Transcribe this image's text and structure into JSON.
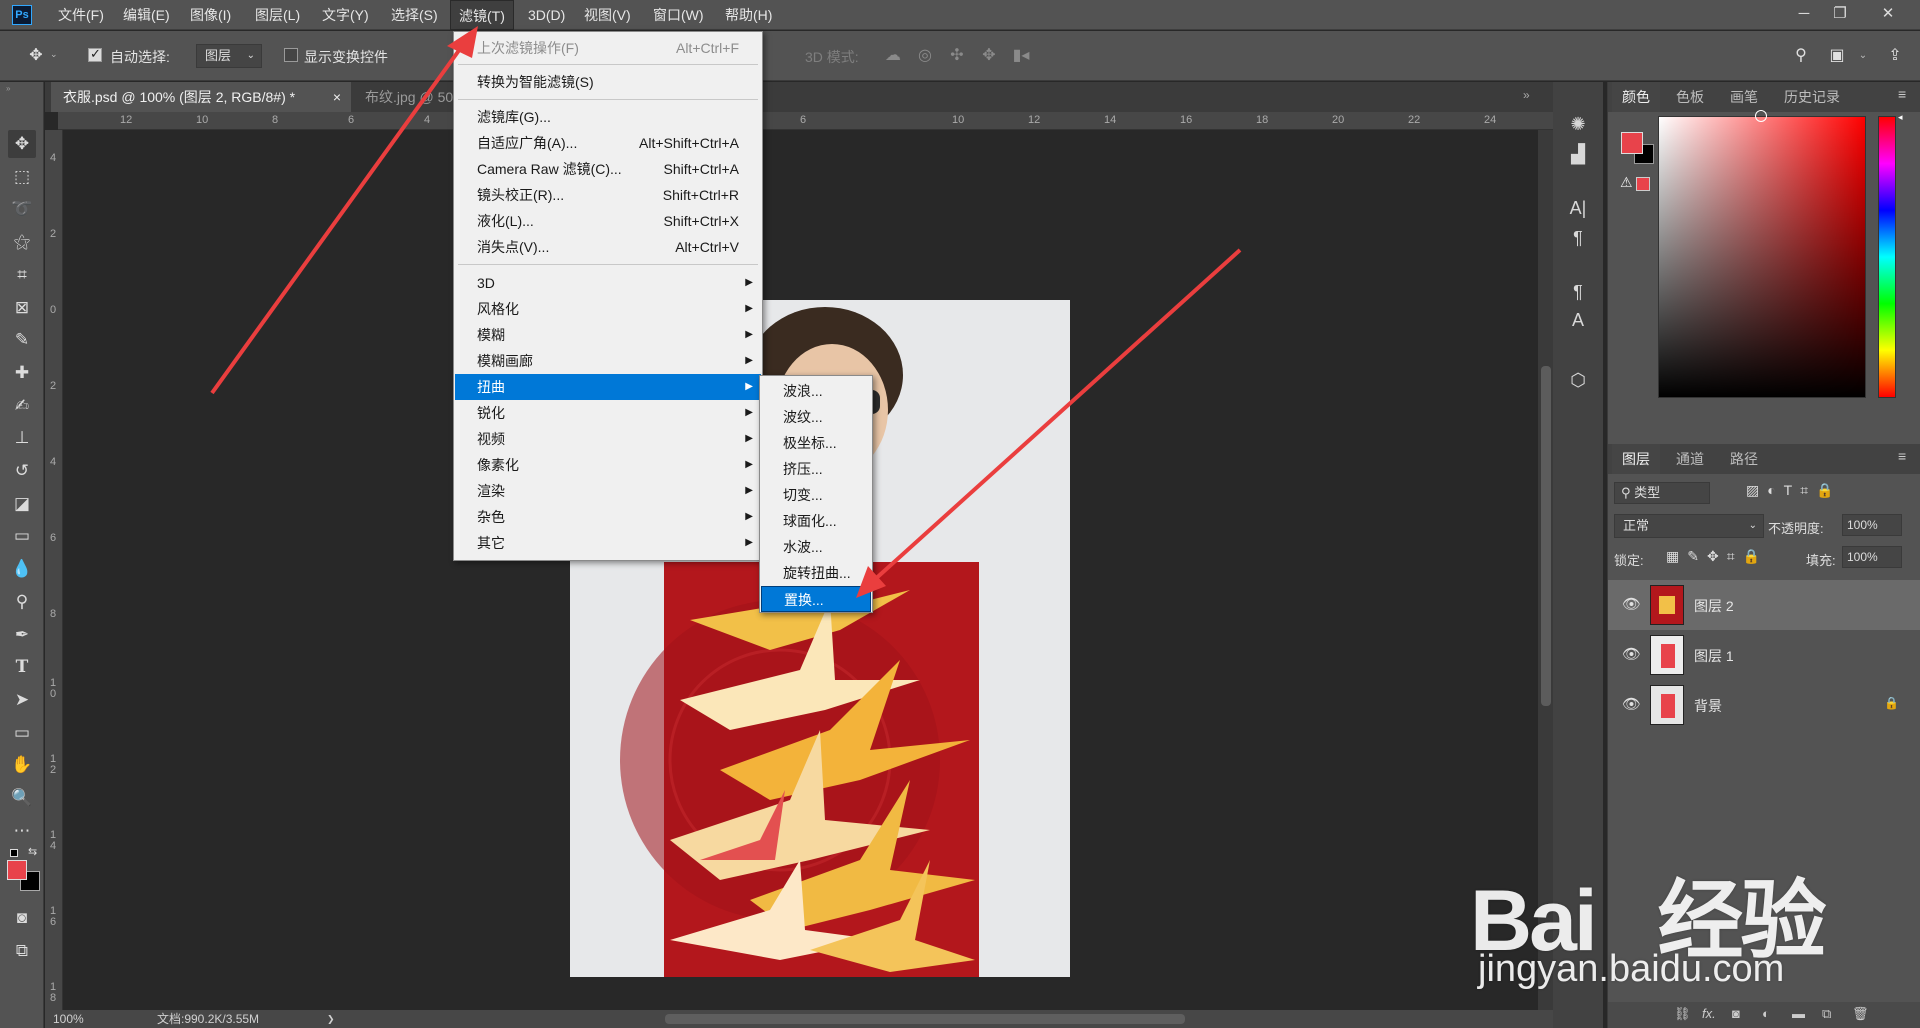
{
  "app": {
    "logo": "Ps"
  },
  "menubar": {
    "items": [
      "文件(F)",
      "编辑(E)",
      "图像(I)",
      "图层(L)",
      "文字(Y)",
      "选择(S)",
      "滤镜(T)",
      "3D(D)",
      "视图(V)",
      "窗口(W)",
      "帮助(H)"
    ],
    "active": "滤镜(T)"
  },
  "window_controls": {
    "minimize": "─",
    "restore": "❐",
    "close": "✕"
  },
  "options_bar": {
    "auto_select_label": "自动选择:",
    "auto_select_checked": true,
    "layer_select_value": "图层",
    "show_transform_label": "显示变换控件",
    "show_transform_checked": false,
    "mode_3d_label": "3D 模式:"
  },
  "tabs": [
    {
      "label": "衣服.psd @ 100% (图层 2, RGB/8#) *",
      "close": "×",
      "active": true
    },
    {
      "label": "布纹.jpg @ 50",
      "active": false
    }
  ],
  "ruler": {
    "h_labels": [
      "12",
      "10",
      "8",
      "6",
      "4",
      "6",
      "10",
      "12",
      "14",
      "16",
      "18",
      "20",
      "22",
      "24"
    ],
    "v_labels": [
      "4",
      "2",
      "0",
      "2",
      "4",
      "6",
      "8",
      "1 0",
      "1 2",
      "1 4",
      "1 6",
      "1 8"
    ]
  },
  "filter_menu": {
    "items": [
      {
        "label": "上次滤镜操作(F)",
        "shortcut": "Alt+Ctrl+F",
        "disabled": true
      },
      {
        "separator": true
      },
      {
        "label": "转换为智能滤镜(S)",
        "shortcut": ""
      },
      {
        "separator": true
      },
      {
        "label": "滤镜库(G)...",
        "shortcut": ""
      },
      {
        "label": "自适应广角(A)...",
        "shortcut": "Alt+Shift+Ctrl+A"
      },
      {
        "label": "Camera Raw 滤镜(C)...",
        "shortcut": "Shift+Ctrl+A"
      },
      {
        "label": "镜头校正(R)...",
        "shortcut": "Shift+Ctrl+R"
      },
      {
        "label": "液化(L)...",
        "shortcut": "Shift+Ctrl+X"
      },
      {
        "label": "消失点(V)...",
        "shortcut": "Alt+Ctrl+V"
      },
      {
        "separator": true
      },
      {
        "label": "3D",
        "submenu": true
      },
      {
        "label": "风格化",
        "submenu": true
      },
      {
        "label": "模糊",
        "submenu": true
      },
      {
        "label": "模糊画廊",
        "submenu": true
      },
      {
        "label": "扭曲",
        "submenu": true,
        "highlighted": true
      },
      {
        "label": "锐化",
        "submenu": true
      },
      {
        "label": "视频",
        "submenu": true
      },
      {
        "label": "像素化",
        "submenu": true
      },
      {
        "label": "渲染",
        "submenu": true
      },
      {
        "label": "杂色",
        "submenu": true
      },
      {
        "label": "其它",
        "submenu": true
      }
    ]
  },
  "distort_submenu": {
    "items": [
      "波浪...",
      "波纹...",
      "极坐标...",
      "挤压...",
      "切变...",
      "球面化...",
      "水波...",
      "旋转扭曲...",
      "置换..."
    ],
    "highlighted": "置换..."
  },
  "color_panel": {
    "tabs": [
      "颜色",
      "色板",
      "画笔",
      "历史记录"
    ],
    "foreground": "#e8434b",
    "background": "#000000",
    "hue_color": "#ff0000"
  },
  "layers_panel": {
    "tabs": [
      "图层",
      "通道",
      "路径"
    ],
    "filter_kind": "类型",
    "blend_mode": "正常",
    "opacity_label": "不透明度:",
    "opacity_value": "100%",
    "lock_label": "锁定:",
    "fill_label": "填充:",
    "fill_value": "100%",
    "layers": [
      {
        "name": "图层 2",
        "selected": true,
        "locked": false
      },
      {
        "name": "图层 1",
        "selected": false,
        "locked": false
      },
      {
        "name": "背景",
        "selected": false,
        "locked": true
      }
    ],
    "bottom_icons": [
      "link-icon",
      "fx-icon",
      "mask-icon",
      "adjustment-icon",
      "group-icon",
      "new-layer-icon",
      "trash-icon"
    ],
    "fx_label": "fx."
  },
  "status": {
    "zoom": "100%",
    "doc_info": "文档:990.2K/3.55M",
    "arrow": "❯"
  },
  "watermark": {
    "logo": "Bai   经验",
    "url": "jingyan.baidu.com"
  },
  "colors": {
    "accent_blue": "#0078d7",
    "arrow_red": "#ea3e3e",
    "swatch_red": "#e8434b",
    "fabric_red": "#b3171c"
  }
}
